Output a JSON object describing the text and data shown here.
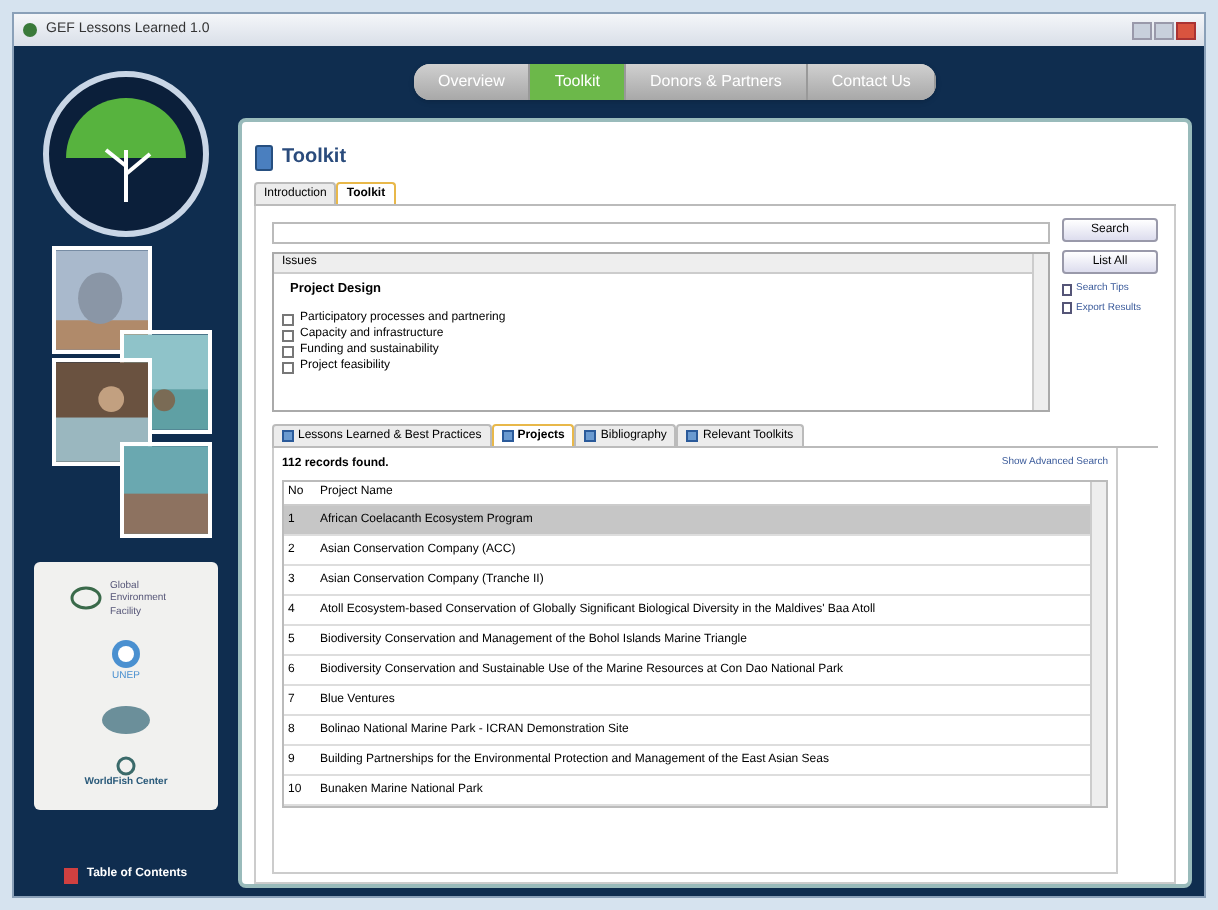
{
  "window": {
    "title": "GEF Lessons Learned 1.0"
  },
  "nav": [
    {
      "label": "Overview",
      "selected": false
    },
    {
      "label": "Toolkit",
      "selected": true
    },
    {
      "label": "Donors & Partners",
      "selected": false
    },
    {
      "label": "Contact Us",
      "selected": false
    }
  ],
  "sidebar": {
    "partners": [
      "Global Environment Facility",
      "UNEP",
      "WorldFish Center"
    ],
    "footer_link": "Table of Contents"
  },
  "page_title": "Toolkit",
  "tabs": [
    {
      "label": "Introduction",
      "selected": false
    },
    {
      "label": "Toolkit",
      "selected": true
    }
  ],
  "search": {
    "button": "Search",
    "list_all": "List All",
    "links": [
      "Search Tips",
      "Export Results"
    ]
  },
  "issues": {
    "header": "Issues",
    "group": "Project Design",
    "items": [
      {
        "label": "Participatory processes and partnering",
        "checked": false
      },
      {
        "label": "Capacity and infrastructure",
        "checked": false
      },
      {
        "label": "Funding and sustainability",
        "checked": false
      },
      {
        "label": "Project feasibility",
        "checked": false
      }
    ]
  },
  "result_tabs": [
    {
      "label": "Lessons Learned & Best Practices",
      "selected": false
    },
    {
      "label": "Projects",
      "selected": true
    },
    {
      "label": "Bibliography",
      "selected": false
    },
    {
      "label": "Relevant Toolkits",
      "selected": false
    }
  ],
  "results": {
    "count": "112 records found.",
    "advanced_link": "Show Advanced Search",
    "columns": [
      "No",
      "Project Name"
    ],
    "rows": [
      {
        "no": "1",
        "name": "African Coelacanth Ecosystem Program",
        "selected": true
      },
      {
        "no": "2",
        "name": "Asian Conservation Company (ACC)",
        "selected": false
      },
      {
        "no": "3",
        "name": "Asian Conservation Company (Tranche II)",
        "selected": false
      },
      {
        "no": "4",
        "name": "Atoll Ecosystem-based Conservation of Globally Significant Biological Diversity in the Maldives' Baa Atoll",
        "selected": false
      },
      {
        "no": "5",
        "name": "Biodiversity Conservation and Management of the Bohol Islands Marine Triangle",
        "selected": false
      },
      {
        "no": "6",
        "name": "Biodiversity Conservation and Sustainable Use of the Marine Resources at Con Dao National Park",
        "selected": false
      },
      {
        "no": "7",
        "name": "Blue Ventures",
        "selected": false
      },
      {
        "no": "8",
        "name": "Bolinao National Marine Park - ICRAN Demonstration Site",
        "selected": false
      },
      {
        "no": "9",
        "name": "Building Partnerships for the Environmental Protection and Management of the East Asian Seas",
        "selected": false
      },
      {
        "no": "10",
        "name": "Bunaken Marine National Park",
        "selected": false
      }
    ]
  }
}
